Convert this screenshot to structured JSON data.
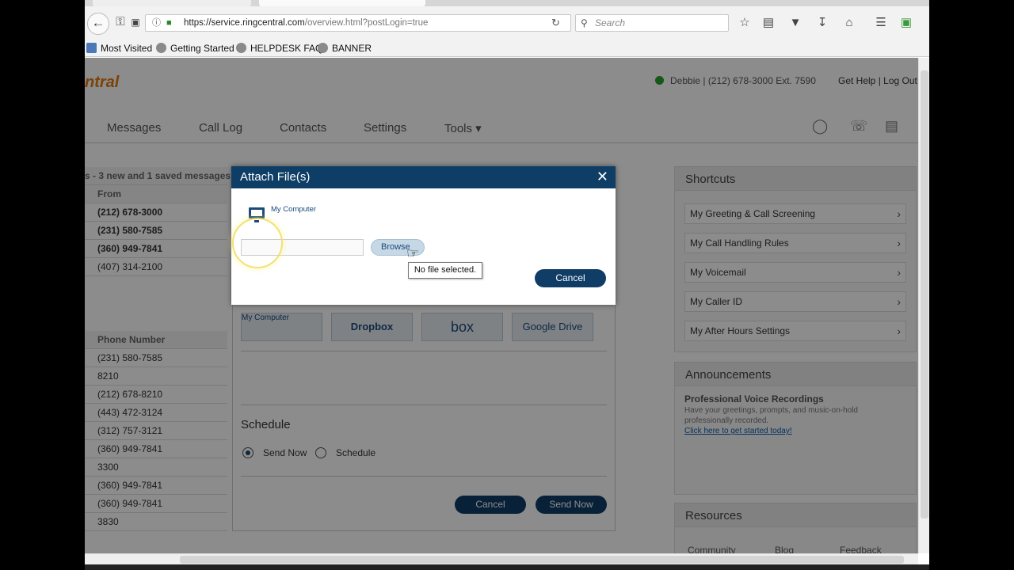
{
  "browser": {
    "url_host": "https://service.ringcentral.com",
    "url_path": "/overview.html?postLogin=true",
    "search_placeholder": "Search",
    "bookmarks": [
      "Most Visited",
      "Getting Started",
      "HELPDESK FAQ",
      "BANNER"
    ]
  },
  "header": {
    "logo": "ntral",
    "account": "Debbie | (212) 678-3000 Ext. 7590",
    "get_help": "Get Help",
    "separator": "|",
    "logout": "Log Out"
  },
  "nav": [
    "Messages",
    "Call Log",
    "Contacts",
    "Settings",
    "Tools ▾"
  ],
  "left_list": {
    "summary": "s - 3 new and 1 saved messages",
    "from_header": "From",
    "from_rows": [
      "(212) 678-3000",
      "(231) 580-7585",
      "(360) 949-7841",
      "(407) 314-2100"
    ],
    "phone_header": "Phone Number",
    "phone_rows": [
      "(231) 580-7585",
      "8210",
      "(212) 678-8210",
      "(443) 472-3124",
      "(312) 757-3121",
      "(360) 949-7841",
      "3300",
      "(360) 949-7841",
      "(360) 949-7841",
      "3830"
    ]
  },
  "shortcuts": {
    "title": "Shortcuts",
    "items": [
      "My Greeting & Call Screening",
      "My Call Handling Rules",
      "My Voicemail",
      "My Caller ID",
      "My After Hours Settings"
    ]
  },
  "announcements": {
    "title": "Announcements",
    "heading": "Professional Voice Recordings",
    "body": "Have your greetings, prompts, and music-on-hold professionally recorded.",
    "link": "Click here to get started today!"
  },
  "resources": {
    "title": "Resources",
    "items": [
      "Community",
      "Blog",
      "Feedback"
    ]
  },
  "under_dialog": {
    "services": [
      "My Computer",
      "Dropbox",
      "box",
      "Google Drive"
    ],
    "schedule_title": "Schedule",
    "send_now_label": "Send Now",
    "schedule_label": "Schedule",
    "cancel": "Cancel",
    "send_now_button": "Send Now"
  },
  "dialog": {
    "title": "Attach File(s)",
    "my_computer": "My Computer",
    "browse": "Browse",
    "tooltip": "No file selected.",
    "cancel": "Cancel"
  }
}
